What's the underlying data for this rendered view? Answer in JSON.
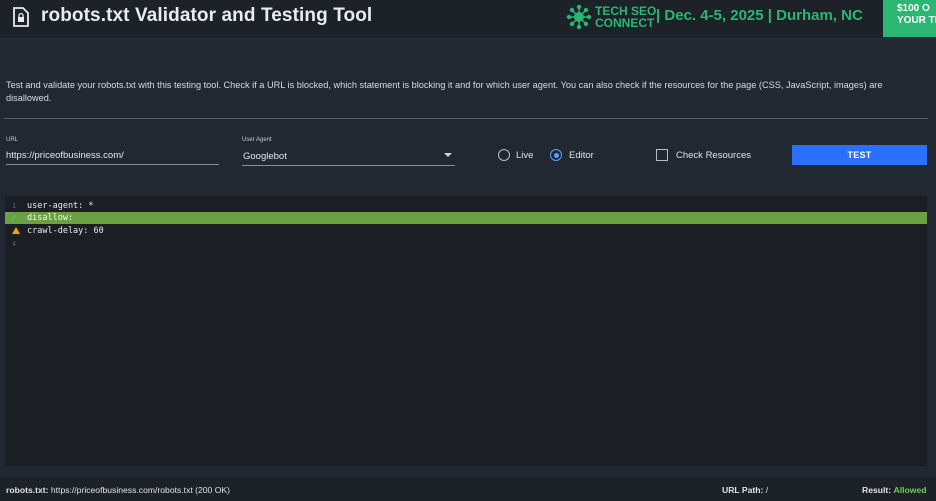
{
  "header": {
    "title": "robots.txt Validator and Testing Tool",
    "promo": {
      "brand_line1": "TECH SEO",
      "brand_line2": "CONNECT",
      "event": "| Dec. 4-5, 2025 | Durham, NC",
      "cta_line1": "$100 O",
      "cta_line2": "YOUR TIC",
      "accent_color": "#2bb673"
    }
  },
  "intro": "Test and validate your robots.txt with this testing tool. Check if a URL is blocked, which statement is blocking it and for which user agent. You can also check if the resources for the page (CSS, JavaScript, images) are disallowed.",
  "form": {
    "url_label": "URL",
    "url_value": "https://priceofbusiness.com/",
    "user_agent_label": "User Agent",
    "user_agent_value": "Googlebot",
    "mode_options": [
      {
        "label": "Live",
        "selected": false
      },
      {
        "label": "Editor",
        "selected": true
      }
    ],
    "check_resources_label": "Check Resources",
    "check_resources_checked": false,
    "test_button": "TEST"
  },
  "editor": {
    "lines": [
      {
        "number": "1",
        "text": "user-agent: *",
        "status": "none",
        "highlighted": false
      },
      {
        "number": "",
        "text": "disallow:",
        "status": "check",
        "highlighted": true
      },
      {
        "number": "",
        "text": "crawl-delay: 60",
        "status": "warning",
        "highlighted": false
      },
      {
        "number": "4",
        "text": "",
        "status": "none",
        "highlighted": false
      }
    ],
    "highlight_color": "#6aa143"
  },
  "footer": {
    "robots_label": "robots.txt:",
    "robots_value": "https://priceofbusiness.com/robots.txt (200 OK)",
    "path_label": "URL Path:",
    "path_value": "/",
    "result_label": "Result:",
    "result_value": "Allowed"
  }
}
